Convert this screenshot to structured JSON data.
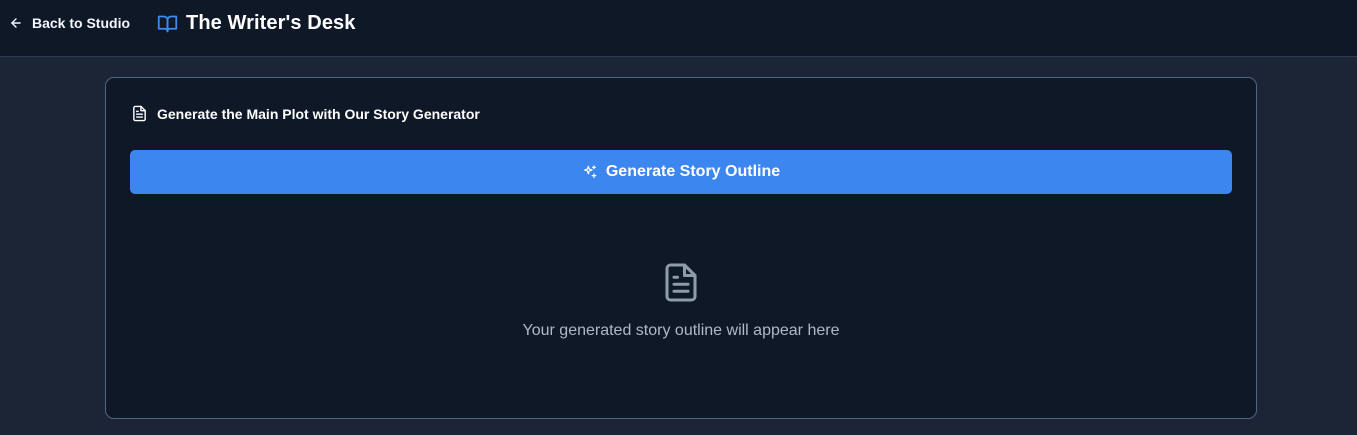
{
  "header": {
    "back_label": "Back to Studio",
    "app_title": "The Writer's Desk",
    "icons": {
      "back": "arrow-left-icon",
      "brand": "book-open-icon"
    },
    "colors": {
      "background": "#0f1827",
      "accent": "#3c86f0"
    }
  },
  "plot_panel": {
    "title": "Generate the Main Plot with Our Story Generator",
    "icon": "document-icon",
    "generate_button_label": "Generate Story Outline",
    "generate_button_icon": "sparkles-icon",
    "empty_state_text": "Your generated story outline will appear here",
    "empty_state_icon": "document-icon",
    "colors": {
      "panel_background": "#0e1827",
      "panel_border": "#4e6784",
      "button_background": "#3c86f0",
      "empty_text": "#aeb8c7"
    }
  }
}
